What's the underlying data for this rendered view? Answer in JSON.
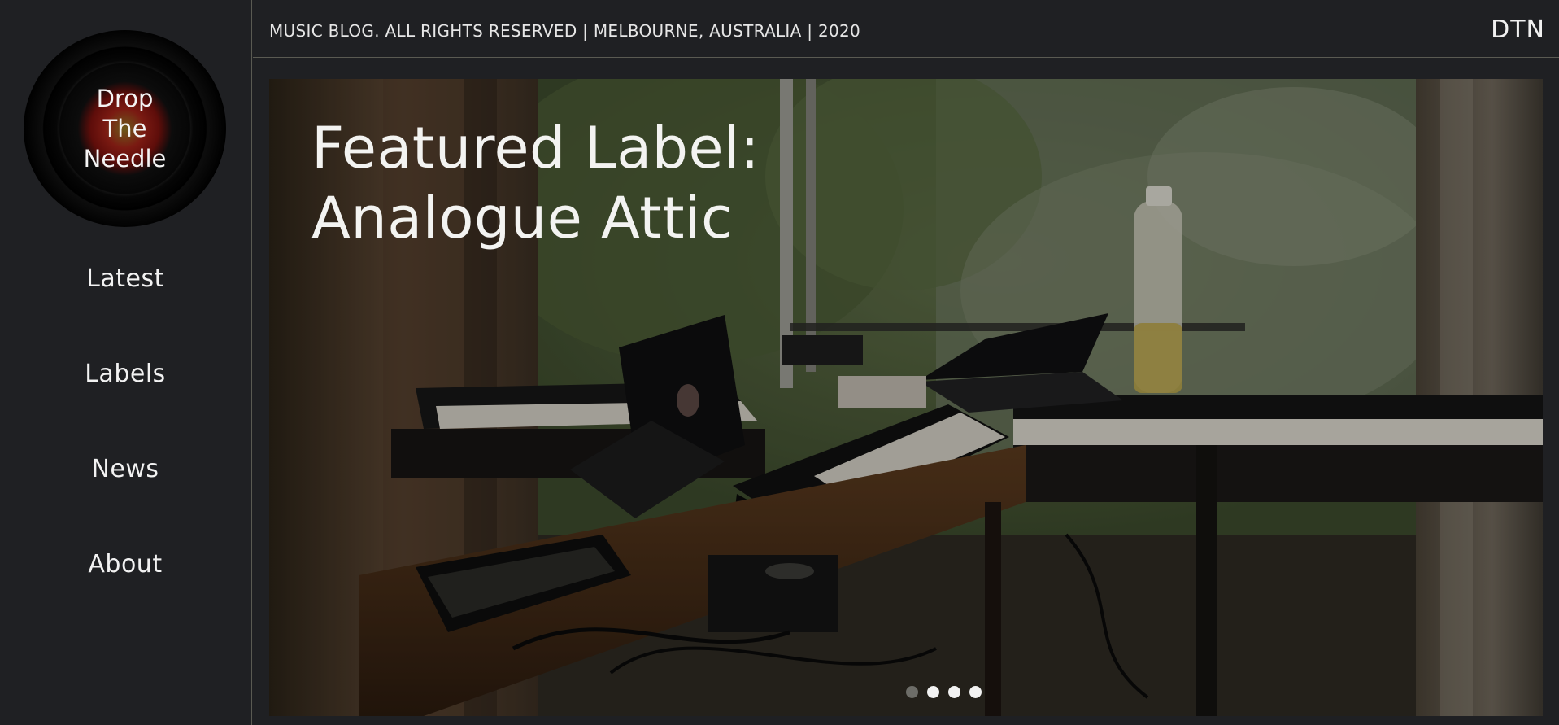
{
  "logo": {
    "line1": "Drop",
    "line2": "The",
    "line3": "Needle"
  },
  "nav": {
    "items": [
      {
        "label": "Latest"
      },
      {
        "label": "Labels"
      },
      {
        "label": "News"
      },
      {
        "label": "About"
      }
    ]
  },
  "topbar": {
    "footer_text": "MUSIC BLOG. ALL RIGHTS RESERVED | MELBOURNE, AUSTRALIA | 2020",
    "brand": "DTN"
  },
  "hero": {
    "title_line1": "Featured Label:",
    "title_line2": "Analogue Attic",
    "slides_total": 4,
    "active_slide": 1
  },
  "colors": {
    "background": "#1f2023",
    "divider": "#5a5a52",
    "text": "#ececec",
    "logo_center": "#7a1a12"
  }
}
